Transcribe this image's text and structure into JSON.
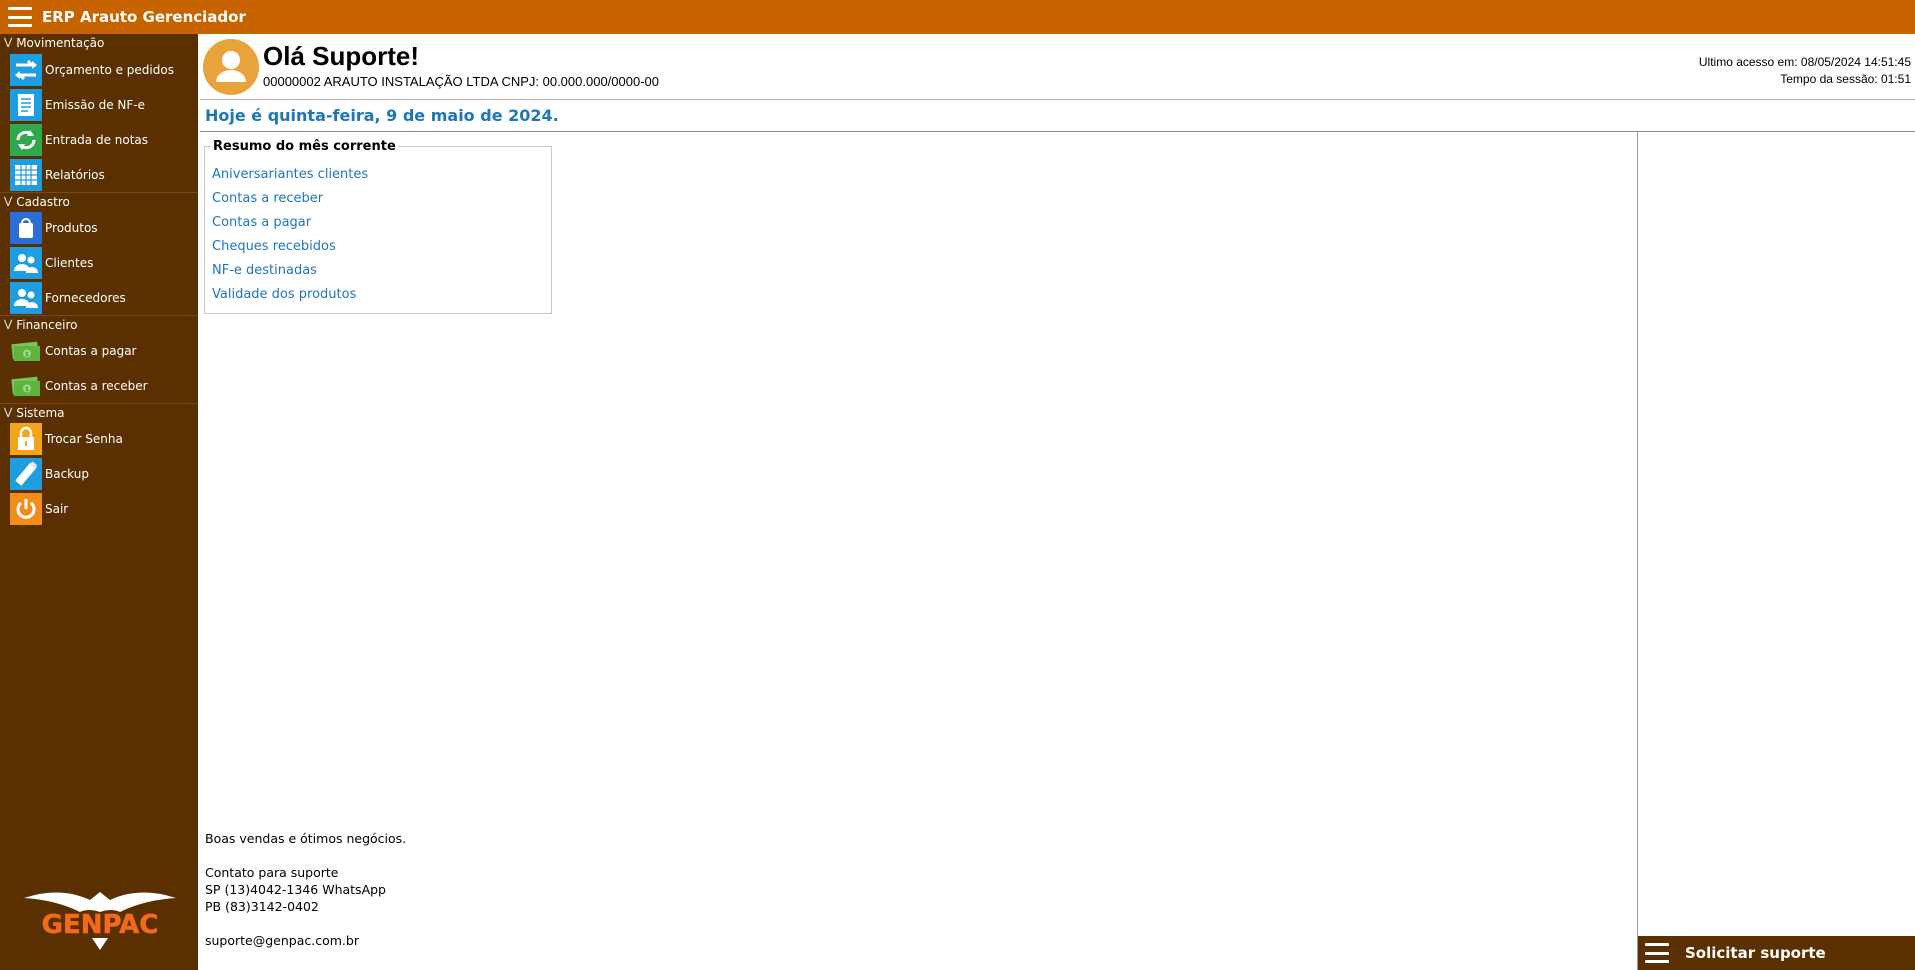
{
  "app": {
    "title": "ERP Arauto Gerenciador"
  },
  "sidebar": {
    "sections": [
      {
        "label": "Movimentação",
        "items": [
          {
            "label": "Orçamento e pedidos",
            "icon": "arrows-exchange-icon"
          },
          {
            "label": "Emissão de NF-e",
            "icon": "document-icon"
          },
          {
            "label": "Entrada de notas",
            "icon": "refresh-icon"
          },
          {
            "label": "Relatórios",
            "icon": "grid-report-icon"
          }
        ]
      },
      {
        "label": "Cadastro",
        "items": [
          {
            "label": "Produtos",
            "icon": "shopping-bag-icon"
          },
          {
            "label": "Clientes",
            "icon": "users-icon"
          },
          {
            "label": "Fornecedores",
            "icon": "users-icon"
          }
        ]
      },
      {
        "label": "Financeiro",
        "items": [
          {
            "label": "Contas a pagar",
            "icon": "money-icon"
          },
          {
            "label": "Contas a receber",
            "icon": "money-icon"
          }
        ]
      },
      {
        "label": "Sistema",
        "items": [
          {
            "label": "Trocar Senha",
            "icon": "lock-icon"
          },
          {
            "label": "Backup",
            "icon": "usb-drive-icon"
          },
          {
            "label": "Sair",
            "icon": "power-icon"
          }
        ]
      }
    ],
    "logo_text": "GENPAC"
  },
  "header": {
    "greeting": "Olá Suporte!",
    "company": "00000002 ARAUTO INSTALAÇÃO LTDA CNPJ: 00.000.000/0000-00",
    "last_access": "Ultimo acesso em: 08/05/2024 14:51:45",
    "session_time": "Tempo da sessão: 01:51"
  },
  "date_line": "Hoje é quinta-feira, 9 de maio de 2024.",
  "resumo": {
    "title": "Resumo do mês corrente",
    "links": [
      "Aniversariantes clientes",
      "Contas a receber",
      "Contas a pagar",
      "Cheques recebidos",
      "NF-e destinadas",
      "Validade dos produtos"
    ]
  },
  "footer": {
    "line1": "Boas vendas e ótimos negócios.",
    "contact_title": "Contato para suporte",
    "sp": "SP (13)4042-1346 WhatsApp",
    "pb": "PB (83)3142-0402",
    "email": "suporte@genpac.com.br"
  },
  "support_button": {
    "label": "Solicitar suporte"
  },
  "colors": {
    "topbar": "#c86400",
    "sidebar": "#5a3000",
    "link": "#1d76b8"
  }
}
